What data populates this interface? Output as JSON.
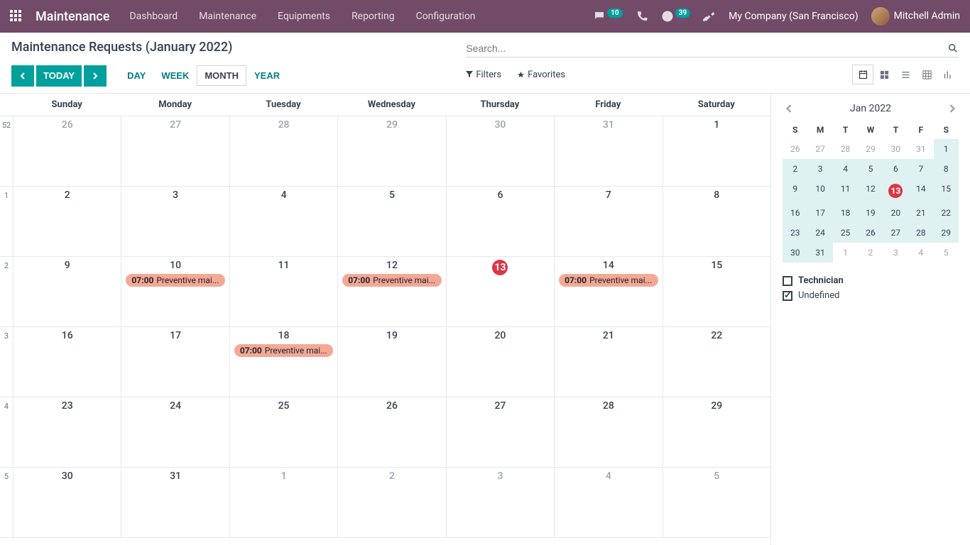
{
  "nav": {
    "brand": "Maintenance",
    "links": [
      "Dashboard",
      "Maintenance",
      "Equipments",
      "Reporting",
      "Configuration"
    ],
    "msg_badge": "10",
    "clock_badge": "39",
    "company": "My Company (San Francisco)",
    "user": "Mitchell Admin"
  },
  "header": {
    "title": "Maintenance Requests (January 2022)",
    "today": "TODAY",
    "scales": {
      "day": "DAY",
      "week": "WEEK",
      "month": "MONTH",
      "year": "YEAR"
    },
    "search_placeholder": "Search...",
    "filters": "Filters",
    "favorites": "Favorites"
  },
  "calendar": {
    "day_headers": [
      "Sunday",
      "Monday",
      "Tuesday",
      "Wednesday",
      "Thursday",
      "Friday",
      "Saturday"
    ],
    "weeks": [
      {
        "num": "52",
        "days": [
          {
            "n": "26",
            "out": true
          },
          {
            "n": "27",
            "out": true
          },
          {
            "n": "28",
            "out": true
          },
          {
            "n": "29",
            "out": true
          },
          {
            "n": "30",
            "out": true
          },
          {
            "n": "31",
            "out": true
          },
          {
            "n": "1"
          }
        ]
      },
      {
        "num": "1",
        "days": [
          {
            "n": "2"
          },
          {
            "n": "3"
          },
          {
            "n": "4"
          },
          {
            "n": "5"
          },
          {
            "n": "6"
          },
          {
            "n": "7"
          },
          {
            "n": "8"
          }
        ]
      },
      {
        "num": "2",
        "days": [
          {
            "n": "9"
          },
          {
            "n": "10",
            "events": [
              {
                "time": "07:00",
                "label": "Preventive mai..."
              }
            ]
          },
          {
            "n": "11"
          },
          {
            "n": "12",
            "events": [
              {
                "time": "07:00",
                "label": "Preventive mai..."
              }
            ]
          },
          {
            "n": "13",
            "today": true
          },
          {
            "n": "14",
            "events": [
              {
                "time": "07:00",
                "label": "Preventive mai..."
              }
            ]
          },
          {
            "n": "15"
          }
        ]
      },
      {
        "num": "3",
        "days": [
          {
            "n": "16"
          },
          {
            "n": "17"
          },
          {
            "n": "18",
            "events": [
              {
                "time": "07:00",
                "label": "Preventive mai..."
              }
            ]
          },
          {
            "n": "19"
          },
          {
            "n": "20"
          },
          {
            "n": "21"
          },
          {
            "n": "22"
          }
        ]
      },
      {
        "num": "4",
        "days": [
          {
            "n": "23"
          },
          {
            "n": "24"
          },
          {
            "n": "25"
          },
          {
            "n": "26"
          },
          {
            "n": "27"
          },
          {
            "n": "28"
          },
          {
            "n": "29"
          }
        ]
      },
      {
        "num": "5",
        "days": [
          {
            "n": "30"
          },
          {
            "n": "31"
          },
          {
            "n": "1",
            "out": true
          },
          {
            "n": "2",
            "out": true
          },
          {
            "n": "3",
            "out": true
          },
          {
            "n": "4",
            "out": true
          },
          {
            "n": "5",
            "out": true
          }
        ]
      }
    ]
  },
  "mini": {
    "title": "Jan 2022",
    "day_headers": [
      "S",
      "M",
      "T",
      "W",
      "T",
      "F",
      "S"
    ],
    "weeks": [
      [
        {
          "n": "26",
          "out": true
        },
        {
          "n": "27",
          "out": true
        },
        {
          "n": "28",
          "out": true
        },
        {
          "n": "29",
          "out": true
        },
        {
          "n": "30",
          "out": true
        },
        {
          "n": "31",
          "out": true
        },
        {
          "n": "1",
          "in": true
        }
      ],
      [
        {
          "n": "2",
          "in": true
        },
        {
          "n": "3",
          "in": true
        },
        {
          "n": "4",
          "in": true
        },
        {
          "n": "5",
          "in": true
        },
        {
          "n": "6",
          "in": true
        },
        {
          "n": "7",
          "in": true
        },
        {
          "n": "8",
          "in": true
        }
      ],
      [
        {
          "n": "9",
          "in": true
        },
        {
          "n": "10",
          "in": true
        },
        {
          "n": "11",
          "in": true
        },
        {
          "n": "12",
          "in": true
        },
        {
          "n": "13",
          "in": true,
          "today": true
        },
        {
          "n": "14",
          "in": true
        },
        {
          "n": "15",
          "in": true
        }
      ],
      [
        {
          "n": "16",
          "in": true
        },
        {
          "n": "17",
          "in": true
        },
        {
          "n": "18",
          "in": true
        },
        {
          "n": "19",
          "in": true
        },
        {
          "n": "20",
          "in": true
        },
        {
          "n": "21",
          "in": true
        },
        {
          "n": "22",
          "in": true
        }
      ],
      [
        {
          "n": "23",
          "in": true
        },
        {
          "n": "24",
          "in": true
        },
        {
          "n": "25",
          "in": true
        },
        {
          "n": "26",
          "in": true
        },
        {
          "n": "27",
          "in": true
        },
        {
          "n": "28",
          "in": true
        },
        {
          "n": "29",
          "in": true
        }
      ],
      [
        {
          "n": "30",
          "in": true
        },
        {
          "n": "31",
          "in": true
        },
        {
          "n": "1",
          "out": true
        },
        {
          "n": "2",
          "out": true
        },
        {
          "n": "3",
          "out": true
        },
        {
          "n": "4",
          "out": true
        },
        {
          "n": "5",
          "out": true
        }
      ]
    ]
  },
  "legend": {
    "technician": "Technician",
    "undefined": "Undefined"
  }
}
